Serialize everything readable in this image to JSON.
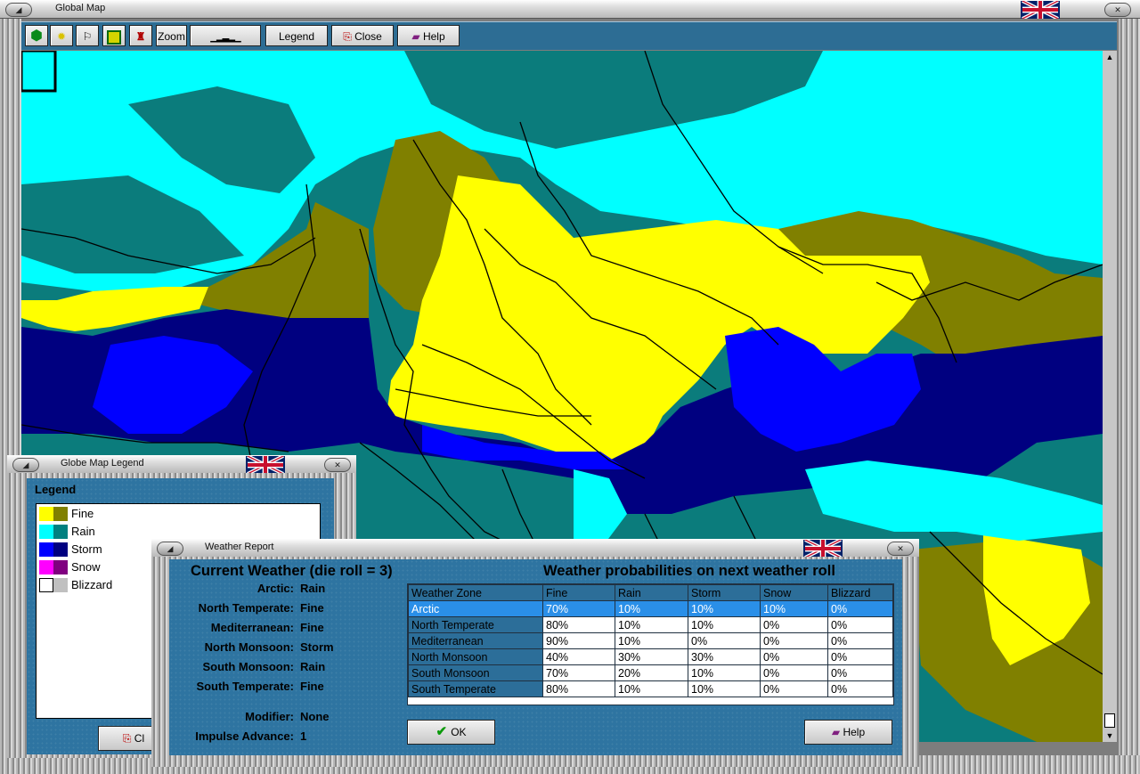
{
  "main_window": {
    "title": "Global Map",
    "toolbar": {
      "zoom_label": "Zoom",
      "legend_label": "Legend",
      "close_label": "Close",
      "help_label": "Help"
    }
  },
  "legend_window": {
    "title": "Globe Map Legend",
    "heading": "Legend",
    "items": [
      {
        "label": "Fine",
        "colors": [
          "#ffff00",
          "#808000"
        ]
      },
      {
        "label": "Rain",
        "colors": [
          "#00ffff",
          "#008080"
        ]
      },
      {
        "label": "Storm",
        "colors": [
          "#0000ff",
          "#000080"
        ]
      },
      {
        "label": "Snow",
        "colors": [
          "#ff00ff",
          "#800080"
        ]
      },
      {
        "label": "Blizzard",
        "colors": [
          "#ffffff",
          "#c0c0c0"
        ]
      }
    ],
    "close_label_partial": "Cl"
  },
  "weather_window": {
    "title": "Weather Report",
    "current_heading": "Current Weather (die roll = 3)",
    "prob_heading": "Weather probabilities on next weather roll",
    "current": [
      {
        "zone": "Arctic:",
        "weather": "Rain"
      },
      {
        "zone": "North Temperate:",
        "weather": "Fine"
      },
      {
        "zone": "Mediterranean:",
        "weather": "Fine"
      },
      {
        "zone": "North Monsoon:",
        "weather": "Storm"
      },
      {
        "zone": "South Monsoon:",
        "weather": "Rain"
      },
      {
        "zone": "South Temperate:",
        "weather": "Fine"
      }
    ],
    "modifier_label": "Modifier:",
    "modifier_value": "None",
    "impulse_label": "Impulse Advance:",
    "impulse_value": "1",
    "table": {
      "headers": [
        "Weather Zone",
        "Fine",
        "Rain",
        "Storm",
        "Snow",
        "Blizzard"
      ],
      "rows": [
        [
          "Arctic",
          "70%",
          "10%",
          "10%",
          "10%",
          "0%"
        ],
        [
          "North Temperate",
          "80%",
          "10%",
          "10%",
          "0%",
          "0%"
        ],
        [
          "Mediterranean",
          "90%",
          "10%",
          "0%",
          "0%",
          "0%"
        ],
        [
          "North Monsoon",
          "40%",
          "30%",
          "30%",
          "0%",
          "0%"
        ],
        [
          "South Monsoon",
          "70%",
          "20%",
          "10%",
          "0%",
          "0%"
        ],
        [
          "South Temperate",
          "80%",
          "10%",
          "10%",
          "0%",
          "0%"
        ]
      ],
      "selected_row": 0
    },
    "ok_label": "OK",
    "help_label": "Help"
  },
  "colors": {
    "fine_light": "#ffff00",
    "fine_dark": "#808000",
    "rain_light": "#00ffff",
    "rain_dark": "#0b7c7c",
    "storm_light": "#0000ff",
    "storm_dark": "#000080",
    "window_blue": "#2e74a1"
  }
}
